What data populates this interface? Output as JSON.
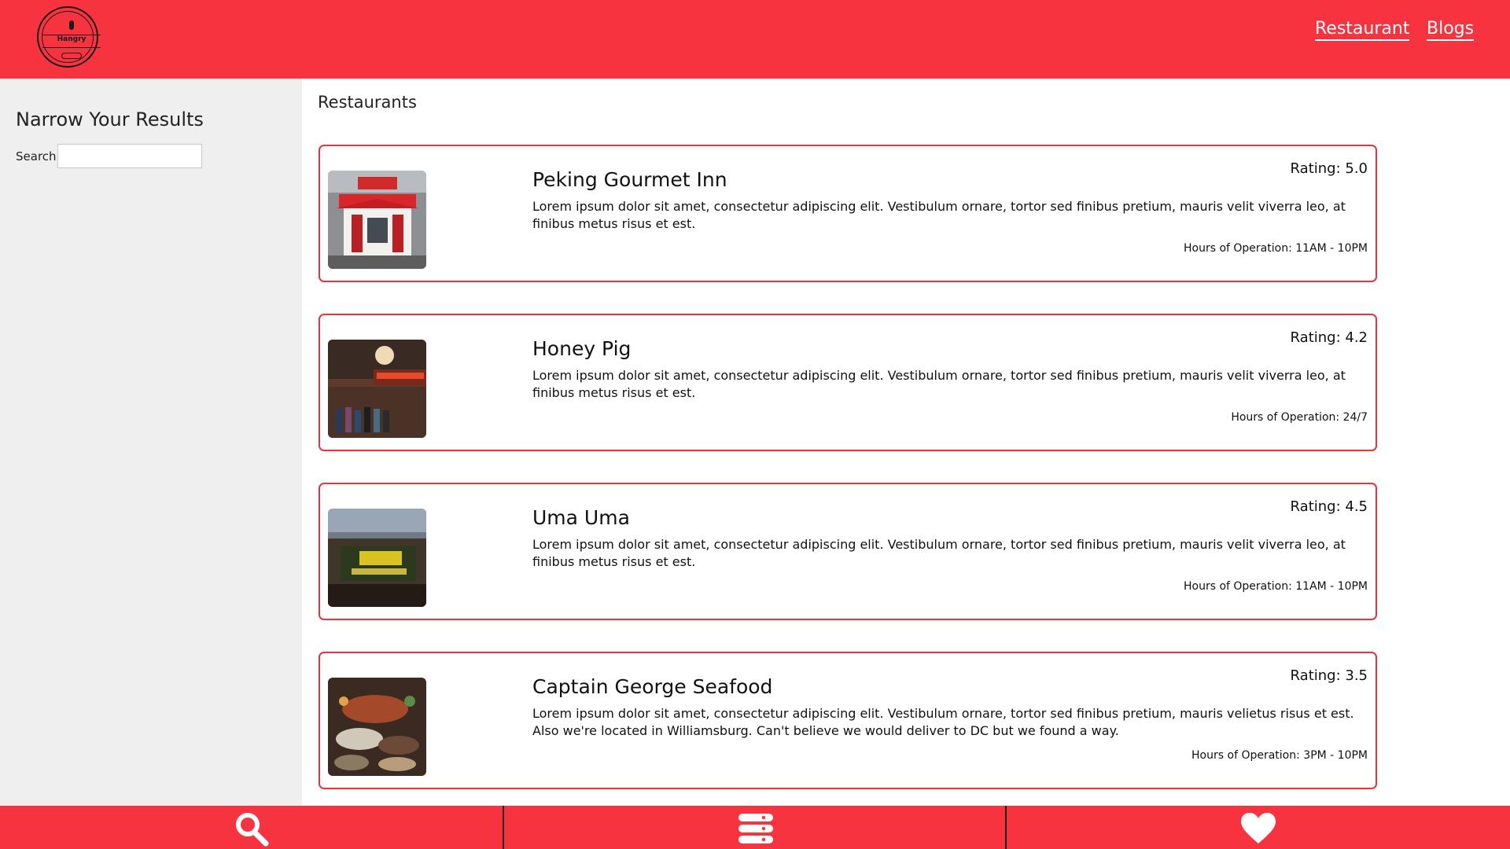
{
  "header": {
    "logo_text": "Hangry",
    "nav": [
      {
        "label": "Restaurant"
      },
      {
        "label": "Blogs"
      }
    ]
  },
  "sidebar": {
    "title": "Narrow Your Results",
    "search_label": "Search",
    "search_value": "",
    "search_placeholder": ""
  },
  "main": {
    "heading": "Restaurants",
    "restaurants": [
      {
        "name": "Peking Gourmet Inn",
        "rating": "Rating: 5.0",
        "description": "Lorem ipsum dolor sit amet, consectetur adipiscing elit. Vestibulum ornare, tortor sed finibus pretium, mauris velit viverra leo, at finibus metus risus et est.",
        "hours": "Hours of Operation: 11AM - 10PM",
        "image": "restaurant-storefront-photo"
      },
      {
        "name": "Honey Pig",
        "rating": "Rating: 4.2",
        "description": "Lorem ipsum dolor sit amet, consectetur adipiscing elit. Vestibulum ornare, tortor sed finibus pretium, mauris velit viverra leo, at finibus metus risus et est.",
        "hours": "Hours of Operation: 24/7",
        "image": "restaurant-queue-photo"
      },
      {
        "name": "Uma Uma",
        "rating": "Rating: 4.5",
        "description": "Lorem ipsum dolor sit amet, consectetur adipiscing elit. Vestibulum ornare, tortor sed finibus pretium, mauris velit viverra leo, at finibus metus risus et est.",
        "hours": "Hours of Operation: 11AM - 10PM",
        "image": "restaurant-sign-photo"
      },
      {
        "name": "Captain George Seafood",
        "rating": "Rating: 3.5",
        "description": "Lorem ipsum dolor sit amet, consectetur adipiscing elit. Vestibulum ornare, tortor sed finibus pretium, mauris velietus risus et est. Also we're located in Williamsburg. Can't believe we would deliver to DC but we found a way.",
        "hours": "Hours of Operation: 3PM - 10PM",
        "image": "seafood-buffet-photo"
      }
    ]
  },
  "bottom_nav": {
    "icons": [
      "search-icon",
      "list-icon",
      "heart-icon"
    ]
  },
  "colors": {
    "brand_red": "#f7333f",
    "card_border": "#e8333f",
    "sidebar_bg": "#efefef"
  }
}
